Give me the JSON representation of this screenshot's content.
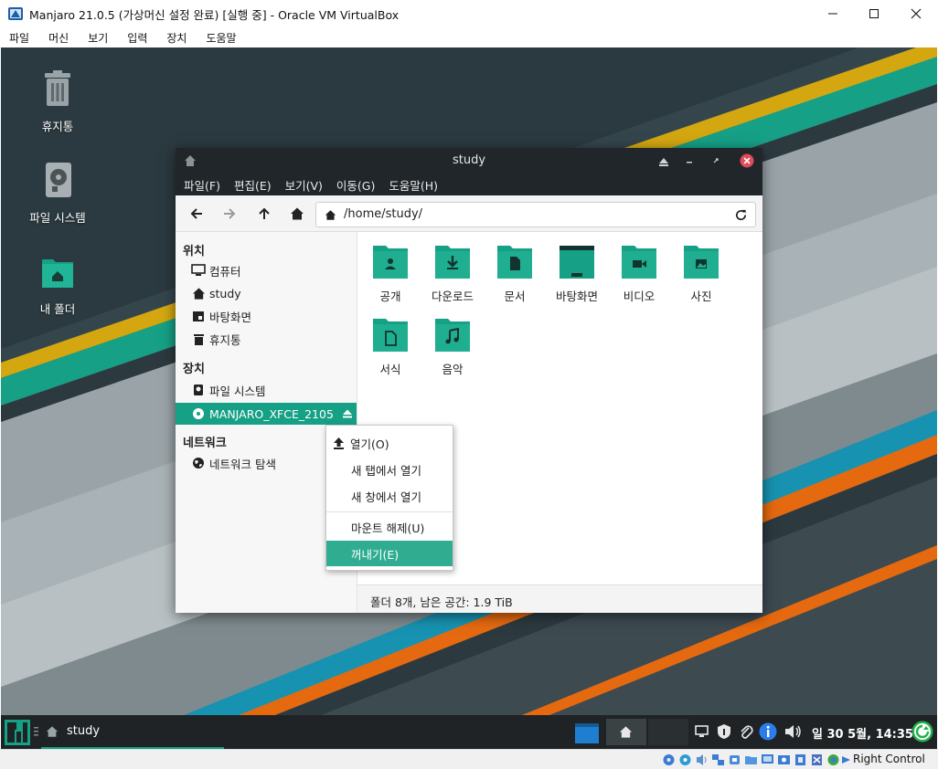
{
  "host": {
    "title": "Manjaro 21.0.5 (가상머신 설정 완료) [실행 중] - Oracle VM VirtualBox",
    "menu": [
      "파일",
      "머신",
      "보기",
      "입력",
      "장치",
      "도움말"
    ],
    "host_key": "Right Control"
  },
  "desktop": {
    "icons": [
      {
        "label": "휴지통",
        "icon": "trash-icon"
      },
      {
        "label": "파일 시스템",
        "icon": "drive-icon"
      },
      {
        "label": "내 폴더",
        "icon": "home-folder-icon"
      }
    ]
  },
  "file_manager": {
    "title": "study",
    "menu": [
      "파일(F)",
      "편집(E)",
      "보기(V)",
      "이동(G)",
      "도움말(H)"
    ],
    "path": "/home/study/",
    "sidebar": {
      "places_header": "위치",
      "places": [
        "컴퓨터",
        "study",
        "바탕화면",
        "휴지통"
      ],
      "devices_header": "장치",
      "devices": [
        "파일 시스템",
        "MANJARO_XFCE_2105"
      ],
      "network_header": "네트워크",
      "network": [
        "네트워크 탐색"
      ]
    },
    "folders": [
      "공개",
      "다운로드",
      "문서",
      "바탕화면",
      "비디오",
      "사진",
      "서식",
      "음악"
    ],
    "status": "폴더 8개, 남은 공간: 1.9 TiB"
  },
  "context_menu": {
    "items": [
      "열기(O)",
      "새 탭에서 열기",
      "새 창에서 열기",
      "마운트 해제(U)",
      "꺼내기(E)"
    ],
    "selected": "꺼내기(E)"
  },
  "panel": {
    "task_label": "study",
    "clock": "일 30 5월, 14:35"
  },
  "colors": {
    "accent": "#16a085",
    "folder": "#16a085",
    "panel": "#1f2325",
    "titlebar": "#20262a"
  }
}
